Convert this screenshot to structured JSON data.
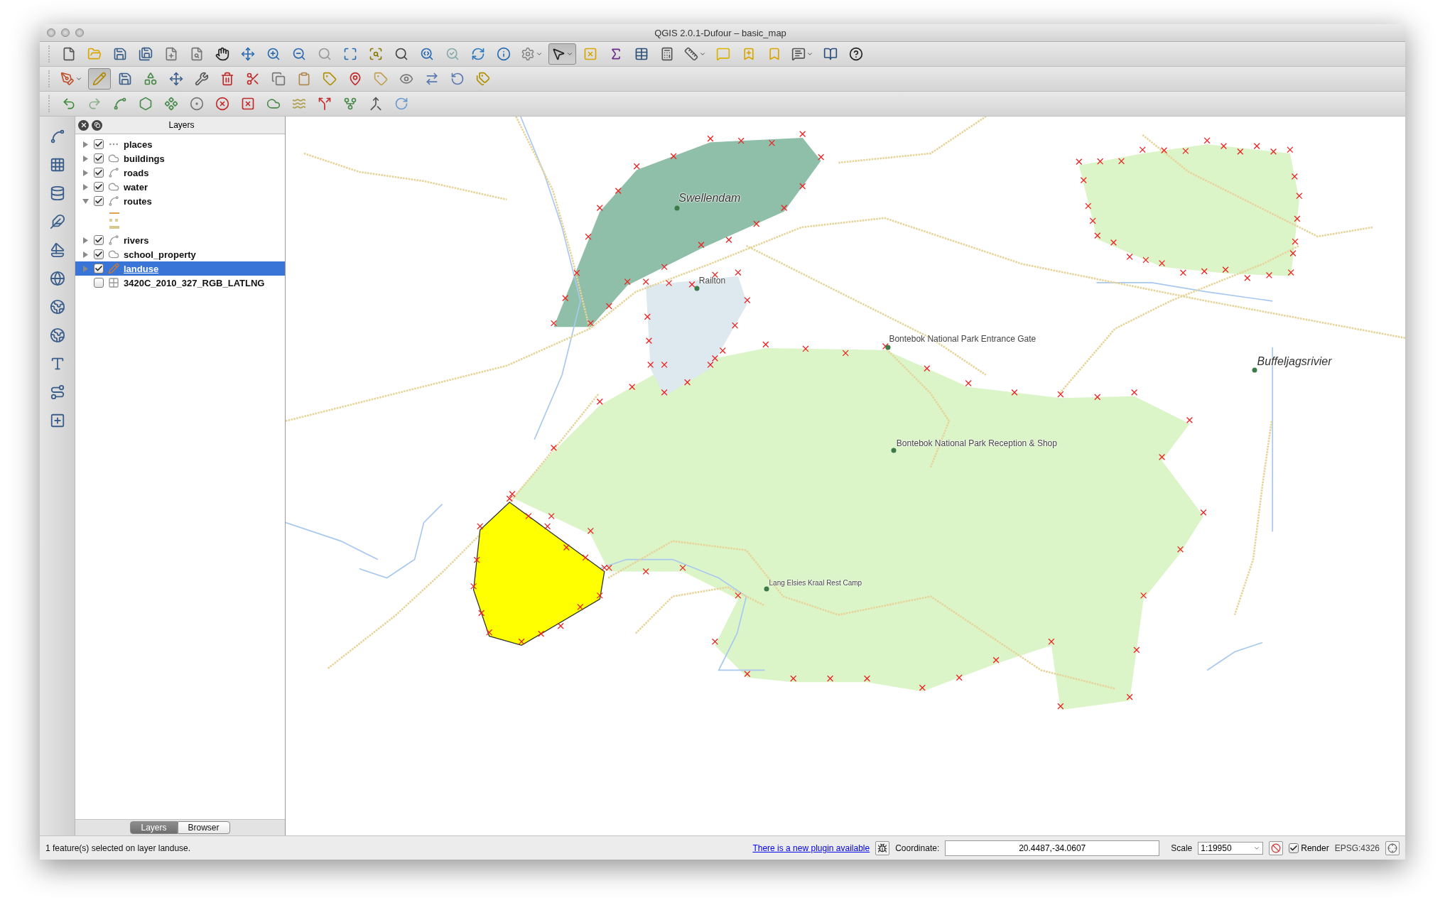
{
  "window": {
    "title": "QGIS 2.0.1-Dufour – basic_map"
  },
  "toolbars": [
    {
      "tools": [
        {
          "kind": "new",
          "pressed": false
        },
        {
          "kind": "open",
          "pressed": false
        },
        {
          "kind": "save",
          "pressed": false
        },
        {
          "kind": "save-as",
          "pressed": false
        },
        {
          "kind": "new-composer",
          "pressed": false
        },
        {
          "kind": "composer-manager",
          "pressed": false
        },
        {
          "kind": "pan",
          "pressed": false
        },
        {
          "kind": "pan-selection",
          "pressed": false
        },
        {
          "kind": "zoom-in",
          "pressed": false
        },
        {
          "kind": "zoom-out",
          "pressed": false
        },
        {
          "kind": "zoom-native",
          "pressed": false
        },
        {
          "kind": "zoom-full",
          "pressed": false
        },
        {
          "kind": "zoom-layer",
          "pressed": false
        },
        {
          "kind": "zoom-selection",
          "pressed": false
        },
        {
          "kind": "zoom-last",
          "pressed": false
        },
        {
          "kind": "zoom-next",
          "pressed": false
        },
        {
          "kind": "refresh",
          "pressed": false
        },
        {
          "kind": "identify",
          "pressed": false
        },
        {
          "kind": "action",
          "pressed": false
        },
        {
          "kind": "select",
          "pressed": true
        },
        {
          "kind": "deselect",
          "pressed": false
        },
        {
          "kind": "expression",
          "pressed": false
        },
        {
          "kind": "attribute-table",
          "pressed": false
        },
        {
          "kind": "statistics",
          "pressed": false
        },
        {
          "kind": "measure",
          "pressed": false
        },
        {
          "kind": "map-tips",
          "pressed": false
        },
        {
          "kind": "new-bookmark",
          "pressed": false
        },
        {
          "kind": "show-bookmarks",
          "pressed": false
        },
        {
          "kind": "annotation",
          "pressed": false
        },
        {
          "kind": "help",
          "pressed": false
        },
        {
          "kind": "whats-this",
          "pressed": false
        }
      ]
    },
    {
      "tools": [
        {
          "kind": "digitize-tools",
          "pressed": false
        },
        {
          "kind": "toggle-editing",
          "pressed": true
        },
        {
          "kind": "save-edits",
          "pressed": false
        },
        {
          "kind": "add-feature",
          "pressed": false
        },
        {
          "kind": "move-feature",
          "pressed": false
        },
        {
          "kind": "node-tool",
          "pressed": false
        },
        {
          "kind": "delete-selected",
          "pressed": false
        },
        {
          "kind": "cut",
          "pressed": false
        },
        {
          "kind": "copy",
          "pressed": false
        },
        {
          "kind": "paste",
          "pressed": false
        },
        {
          "kind": "label-layer",
          "pressed": false
        },
        {
          "kind": "label-pin",
          "pressed": false
        },
        {
          "kind": "label-diagram",
          "pressed": false
        },
        {
          "kind": "label-show",
          "pressed": false
        },
        {
          "kind": "label-move",
          "pressed": false
        },
        {
          "kind": "label-rotate",
          "pressed": false
        },
        {
          "kind": "label-change",
          "pressed": false
        }
      ]
    },
    {
      "tools": [
        {
          "kind": "undo",
          "pressed": false
        },
        {
          "kind": "redo",
          "pressed": false
        },
        {
          "kind": "simplify",
          "pressed": false
        },
        {
          "kind": "add-ring",
          "pressed": false
        },
        {
          "kind": "add-part",
          "pressed": false
        },
        {
          "kind": "fill-ring",
          "pressed": false
        },
        {
          "kind": "delete-ring",
          "pressed": false
        },
        {
          "kind": "delete-part",
          "pressed": false
        },
        {
          "kind": "reshape",
          "pressed": false
        },
        {
          "kind": "offset-curve",
          "pressed": false
        },
        {
          "kind": "split-features",
          "pressed": false
        },
        {
          "kind": "split-parts",
          "pressed": false
        },
        {
          "kind": "merge",
          "pressed": false
        },
        {
          "kind": "rotate",
          "pressed": false
        }
      ]
    }
  ],
  "layers_panel": {
    "title": "Layers",
    "layers": [
      {
        "name": "places",
        "kind": "point",
        "visible": true,
        "expanded": false,
        "selected": false
      },
      {
        "name": "buildings",
        "kind": "polygon",
        "visible": true,
        "expanded": false,
        "selected": false
      },
      {
        "name": "roads",
        "kind": "line",
        "visible": true,
        "expanded": false,
        "selected": false
      },
      {
        "name": "water",
        "kind": "polygon",
        "visible": true,
        "expanded": false,
        "selected": false
      },
      {
        "name": "routes",
        "kind": "line",
        "visible": true,
        "expanded": true,
        "selected": false
      },
      {
        "name": "rivers",
        "kind": "line",
        "visible": true,
        "expanded": false,
        "selected": false
      },
      {
        "name": "school_property",
        "kind": "polygon",
        "visible": true,
        "expanded": false,
        "selected": false
      },
      {
        "name": "landuse",
        "kind": "editing",
        "visible": true,
        "expanded": false,
        "selected": true
      },
      {
        "name": "3420C_2010_327_RGB_LATLNG",
        "kind": "raster",
        "visible": false,
        "selected": false
      }
    ],
    "tabs": [
      {
        "label": "Layers",
        "selected": true
      },
      {
        "label": "Browser",
        "selected": false
      }
    ]
  },
  "map": {
    "labels": [
      {
        "text": "Swellendam",
        "kind": "town"
      },
      {
        "text": "Railton",
        "kind": "place"
      },
      {
        "text": "Bontebok National Park Entrance Gate",
        "kind": "place"
      },
      {
        "text": "Bontebok National Park Reception & Shop",
        "kind": "place"
      },
      {
        "text": "Lang Elsies Kraal Rest Camp",
        "kind": "small"
      },
      {
        "text": "Buffeljagsrivier",
        "kind": "town"
      }
    ]
  },
  "status_bar": {
    "message": "1 feature(s) selected on layer landuse.",
    "plugin_link": "There is a new plugin available",
    "coordinate_label": "Coordinate:",
    "coordinate": "20.4487,-34.0607",
    "scale_label": "Scale",
    "scale": "1:19950",
    "render": {
      "label": "Render",
      "checked": true
    },
    "crs": "EPSG:4326"
  }
}
